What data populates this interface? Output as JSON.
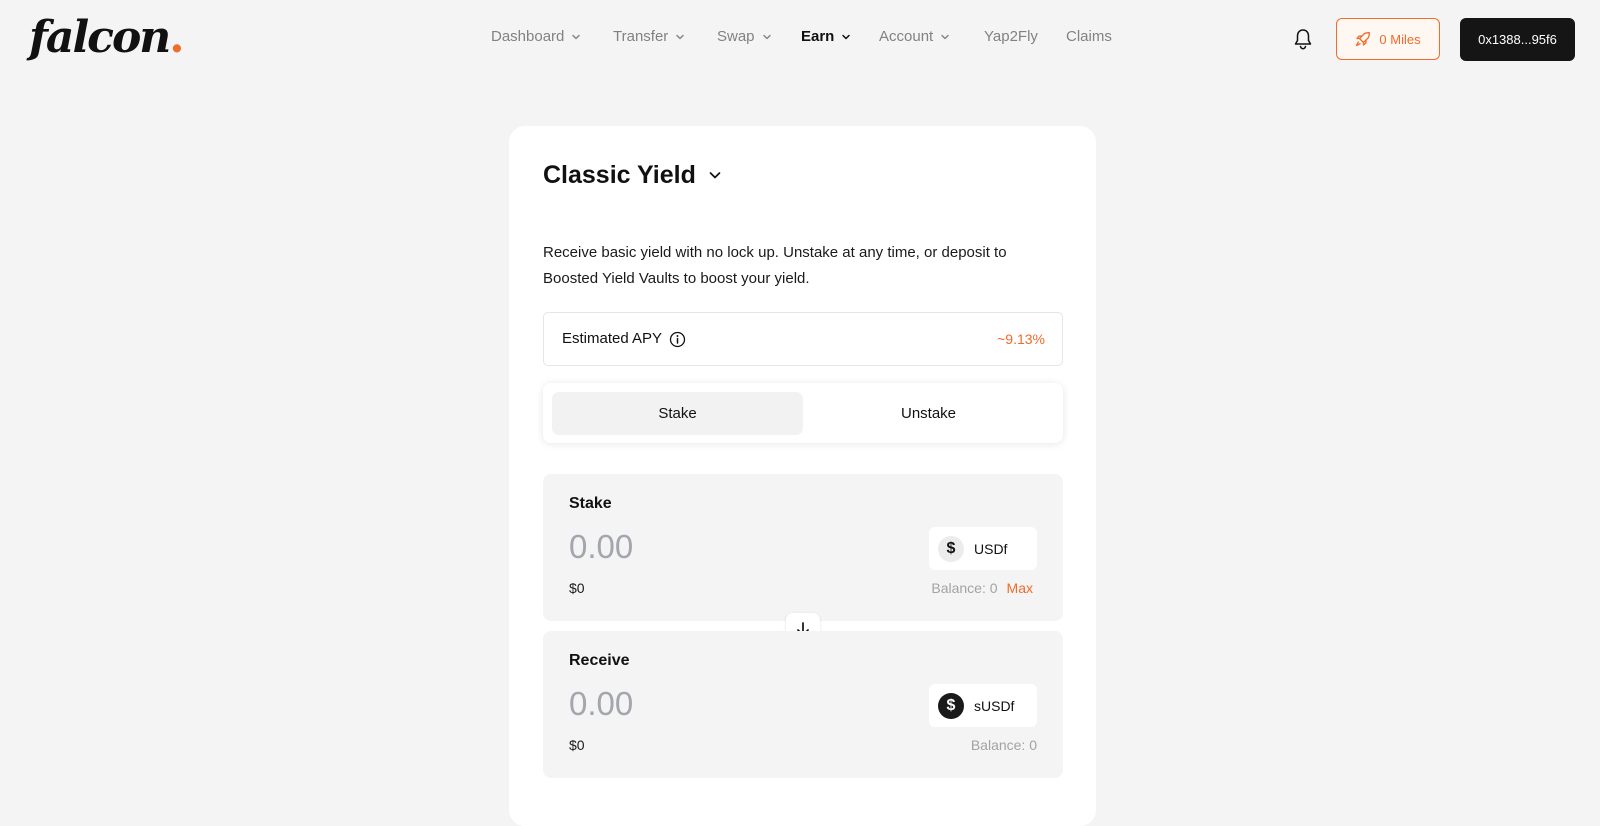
{
  "header": {
    "logo": "falcon",
    "logo_dot": ".",
    "nav": [
      {
        "label": "Dashboard",
        "has_dropdown": true,
        "active": false
      },
      {
        "label": "Transfer",
        "has_dropdown": true,
        "active": false
      },
      {
        "label": "Swap",
        "has_dropdown": true,
        "active": false
      },
      {
        "label": "Earn",
        "has_dropdown": true,
        "active": true
      },
      {
        "label": "Account",
        "has_dropdown": true,
        "active": false
      },
      {
        "label": "Yap2Fly",
        "has_dropdown": false,
        "active": false
      },
      {
        "label": "Claims",
        "has_dropdown": false,
        "active": false
      }
    ],
    "notification_icon": "bell-icon",
    "miles_label": "0 Miles",
    "miles_icon": "rocket-icon",
    "wallet_address": "0x1388...95f6"
  },
  "card": {
    "title": "Classic Yield",
    "description": "Receive basic yield with no lock up. Unstake at any time, or deposit to Boosted Yield Vaults to boost your yield.",
    "apy": {
      "label": "Estimated APY",
      "value": "~9.13%",
      "icon": "info-icon"
    },
    "tabs": [
      {
        "label": "Stake",
        "active": true
      },
      {
        "label": "Unstake",
        "active": false
      }
    ],
    "stake_panel": {
      "title": "Stake",
      "amount_placeholder": "0.00",
      "token": "USDf",
      "usd_value": "$0",
      "balance": "Balance: 0",
      "max_label": "Max"
    },
    "receive_panel": {
      "title": "Receive",
      "amount_placeholder": "0.00",
      "token": "sUSDf",
      "usd_value": "$0",
      "balance": "Balance: 0"
    },
    "swap_icon": "arrow-down-icon"
  },
  "colors": {
    "accent": "#ee6c2c",
    "background": "#f4f4f4",
    "card": "#ffffff",
    "wallet_button": "#151515"
  }
}
